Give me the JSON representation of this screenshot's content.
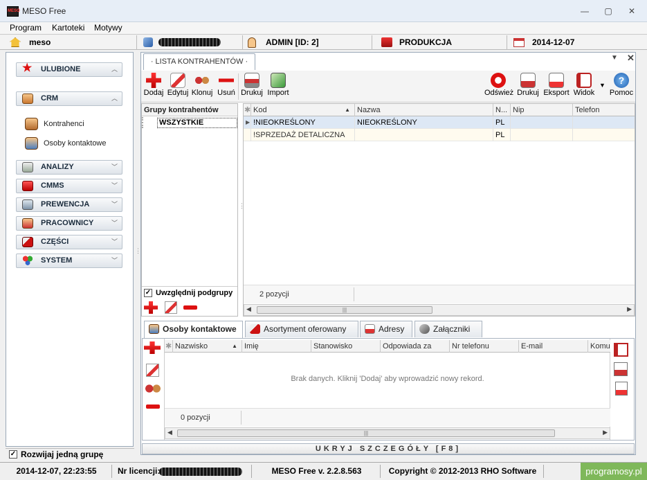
{
  "window": {
    "title": "MESO Free",
    "app_icon_text": "MESO"
  },
  "menu": [
    "Program",
    "Kartoteki",
    "Motywy"
  ],
  "infobar": {
    "home": "meso",
    "user": "ADMIN [ID: 2]",
    "company": "PRODUKCJA",
    "date": "2014-12-07"
  },
  "sidebar": {
    "groups": [
      {
        "label": "ULUBIONE",
        "icon": "star-icon"
      },
      {
        "label": "CRM",
        "icon": "people-icon"
      },
      {
        "label": "ANALIZY",
        "icon": "chart-icon"
      },
      {
        "label": "CMMS",
        "icon": "gears-icon"
      },
      {
        "label": "PREWENCJA",
        "icon": "wrench-icon"
      },
      {
        "label": "PRACOWNICY",
        "icon": "workers-icon"
      },
      {
        "label": "CZĘŚCI",
        "icon": "box-icon"
      },
      {
        "label": "SYSTEM",
        "icon": "system-icon"
      }
    ],
    "crm_items": [
      "Kontrahenci",
      "Osoby kontaktowe"
    ],
    "expand_one_label": "Rozwijaj jedną grupę",
    "expand_one_checked": true
  },
  "tab": {
    "label": "· LISTA KONTRAHENTÓW ·"
  },
  "toolbar": {
    "left": [
      "Dodaj",
      "Edytuj",
      "Klonuj",
      "Usuń",
      "Drukuj",
      "Import"
    ],
    "right": [
      "Odśwież",
      "Drukuj",
      "Eksport",
      "Widok",
      "Pomoc"
    ]
  },
  "groups_panel": {
    "header": "Grupy kontrahentów",
    "item": "WSZYSTKIE",
    "include_sub_label": "Uwzględnij podgrupy",
    "include_sub_checked": true
  },
  "grid": {
    "columns": [
      "Kod",
      "Nazwa",
      "N...",
      "Nip",
      "Telefon"
    ],
    "rows": [
      {
        "kod": "!NIEOKREŚLONY",
        "nazwa": "NIEOKREŚLONY",
        "n": "PL",
        "nip": "",
        "telefon": ""
      },
      {
        "kod": "!SPRZEDAŻ DETALICZNA",
        "nazwa": "",
        "n": "PL",
        "nip": "",
        "telefon": ""
      }
    ],
    "count": "2 pozycji"
  },
  "detail_tabs": [
    "Osoby kontaktowe",
    "Asortyment oferowany",
    "Adresy",
    "Załączniki"
  ],
  "detail_grid": {
    "columns": [
      "Nazwisko",
      "Imię",
      "Stanowisko",
      "Odpowiada za",
      "Nr telefonu",
      "E-mail",
      "Komun"
    ],
    "empty_text": "Brak danych. Kliknij 'Dodaj' aby wprowadzić nowy rekord.",
    "count": "0 pozycji"
  },
  "hide_details_label": "UKRYJ SZCZEGÓŁY [F8]",
  "status": {
    "datetime": "2014-12-07,  22:23:55",
    "license_label": "Nr licencji:",
    "version": "MESO Free v. 2.2.8.563",
    "copyright": "Copyright © 2012-2013 RHO Software",
    "watermark": "programosy.pl"
  },
  "colors": {
    "accent": "#1c3a5e",
    "selection": "#dfe9f5",
    "add": "#d11",
    "remove": "#c00"
  }
}
